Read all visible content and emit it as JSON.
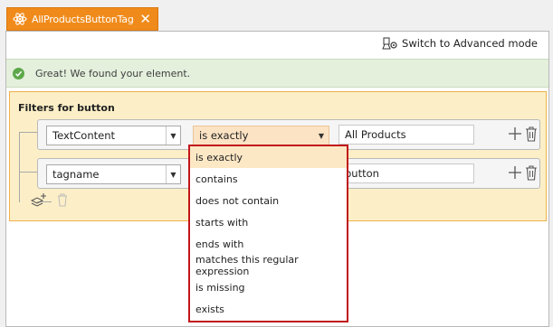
{
  "tab": {
    "title": "AllProductsButtonTag",
    "close_glyph": "✕",
    "icon": "atom-icon"
  },
  "toolbar": {
    "advanced_label": "Switch to Advanced mode",
    "icon": "advanced-mode-icon"
  },
  "notification": {
    "message": "Great! We found your element.",
    "icon": "check-circle-icon"
  },
  "filters": {
    "header": "Filters for button",
    "rows": [
      {
        "attribute": "TextContent",
        "operator": "is exactly",
        "value": "All Products"
      },
      {
        "attribute": "tagname",
        "operator": "",
        "value": "button"
      }
    ]
  },
  "dropdown": {
    "selected": "is exactly",
    "options": [
      "is exactly",
      "contains",
      "does not contain",
      "starts with",
      "ends with",
      "matches this regular expression",
      "is missing",
      "exists"
    ]
  },
  "colors": {
    "tab_accent": "#f08b1b",
    "success_bg": "#e4f0dc",
    "success_icon": "#5da84a",
    "filter_bg": "#fcefc7",
    "filter_border": "#f0b04c",
    "dropdown_border": "#c1151a",
    "selected_option_bg": "#fde8c5"
  }
}
